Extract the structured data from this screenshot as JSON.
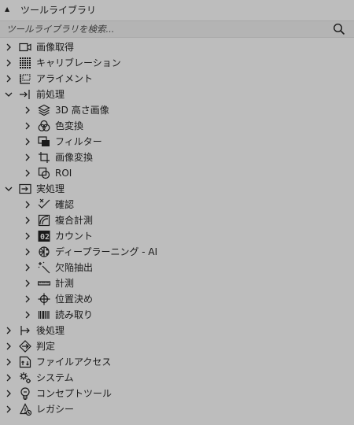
{
  "header": {
    "title": "ツールライブラリ",
    "collapse_glyph": "▲"
  },
  "search": {
    "placeholder": "ツールライブラリを検索..."
  },
  "tree": [
    {
      "label": "画像取得",
      "icon": "camera-icon",
      "expanded": false
    },
    {
      "label": "キャリブレーション",
      "icon": "calibration-grid-icon",
      "expanded": false
    },
    {
      "label": "アライメント",
      "icon": "alignment-icon",
      "expanded": false
    },
    {
      "label": "前処理",
      "icon": "preprocess-arrow-icon",
      "expanded": true,
      "children": [
        {
          "label": "3D 高さ画像",
          "icon": "layers-3d-icon"
        },
        {
          "label": "色変換",
          "icon": "color-circles-icon"
        },
        {
          "label": "フィルター",
          "icon": "filter-icon"
        },
        {
          "label": "画像変換",
          "icon": "crop-icon"
        },
        {
          "label": "ROI",
          "icon": "roi-icon"
        }
      ]
    },
    {
      "label": "実処理",
      "icon": "process-arrow-icon",
      "expanded": true,
      "children": [
        {
          "label": "確認",
          "icon": "check-icon"
        },
        {
          "label": "複合計測",
          "icon": "composite-measure-icon"
        },
        {
          "label": "カウント",
          "icon": "count-icon"
        },
        {
          "label": "ディープラーニング - AI",
          "icon": "deep-learning-icon"
        },
        {
          "label": "欠陥抽出",
          "icon": "defect-wand-icon"
        },
        {
          "label": "計測",
          "icon": "ruler-icon"
        },
        {
          "label": "位置決め",
          "icon": "crosshair-icon"
        },
        {
          "label": "読み取り",
          "icon": "barcode-icon"
        }
      ]
    },
    {
      "label": "後処理",
      "icon": "postprocess-arrow-icon",
      "expanded": false
    },
    {
      "label": "判定",
      "icon": "judge-icon",
      "expanded": false
    },
    {
      "label": "ファイルアクセス",
      "icon": "file-access-icon",
      "expanded": false
    },
    {
      "label": "システム",
      "icon": "system-gear-icon",
      "expanded": false
    },
    {
      "label": "コンセプトツール",
      "icon": "concept-bulb-icon",
      "expanded": false
    },
    {
      "label": "レガシー",
      "icon": "legacy-icon",
      "expanded": false
    }
  ]
}
